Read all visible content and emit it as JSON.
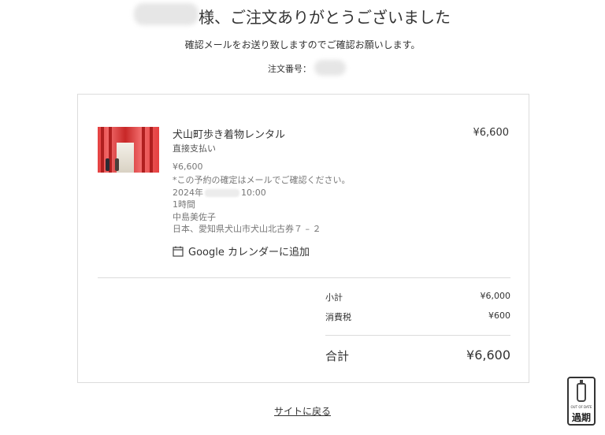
{
  "header": {
    "title": "様、ご注文ありがとうございました",
    "subtitle": "確認メールをお送り致しますのでご確認お願いします。",
    "order_number_label": "注文番号："
  },
  "item": {
    "name": "犬山町歩き着物レンタル",
    "payment_method": "直接支払い",
    "price": "¥6,600",
    "details": {
      "unit_price": "¥6,600",
      "note": "*この予約の確定はメールでご確認ください。",
      "date_prefix": "2024年",
      "time": "10:00",
      "duration": "1時間",
      "contact_name": "中島美佐子",
      "address": "日本、愛知県犬山市犬山北古券７ – ２"
    },
    "calendar_link_label": "Google カレンダーに追加"
  },
  "summary": {
    "subtotal_label": "小計",
    "subtotal_value": "¥6,000",
    "tax_label": "消費税",
    "tax_value": "¥600",
    "total_label": "合計",
    "total_value": "¥6,600"
  },
  "footer": {
    "back_link_label": "サイトに戻る"
  },
  "badge": {
    "small_text": "OUT OF DATE",
    "kanji": "過期"
  },
  "icons": {
    "calendar": "calendar-icon",
    "badge": "milk-bottle-icon"
  },
  "colors": {
    "text": "#333333",
    "muted": "#777777",
    "border": "#dcdcdc",
    "thumbnail_accent": "#e54040"
  }
}
